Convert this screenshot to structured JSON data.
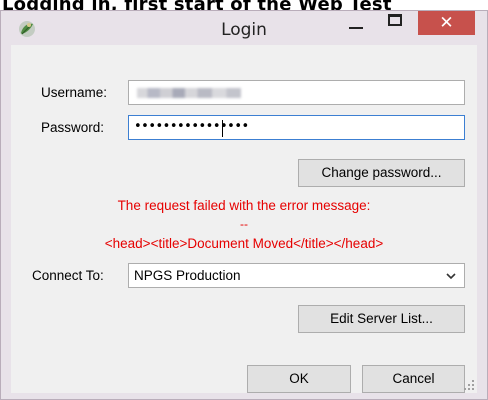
{
  "caption_above": "Logging in, first start of the Web Test",
  "window": {
    "title": "Login"
  },
  "title_buttons": {
    "minimize": "—",
    "maximize": "□",
    "close": "✕"
  },
  "form": {
    "username_label": "Username:",
    "password_label": "Password:",
    "password_mask": "••••••••••••••••",
    "change_password_button": "Change password...",
    "error_message_line1": "The request failed with the error message:",
    "error_message_line2": "--",
    "error_message_line3": "<head><title>Document Moved</title></head>",
    "connect_to_label": "Connect To:",
    "connect_to_value": "NPGS Production",
    "edit_server_list_button": "Edit Server List...",
    "ok_button": "OK",
    "cancel_button": "Cancel"
  },
  "colors": {
    "error_text": "#e60000",
    "close_button": "#c7514c",
    "window_frame": "#e8e2e9",
    "client_background": "#f0f0f0",
    "focus_border": "#3c7fd2"
  },
  "icons": {
    "app": "npgs-leaf-icon",
    "dropdown": "chevron-down-icon",
    "grip": "resize-grip-icon"
  }
}
